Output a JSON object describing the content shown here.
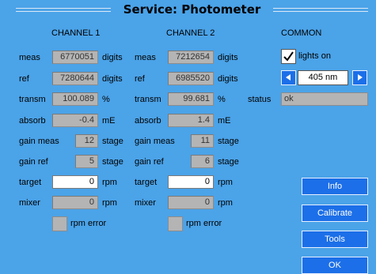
{
  "title": "Service: Photometer",
  "headers": {
    "channel1": "CHANNEL 1",
    "channel2": "CHANNEL 2",
    "common": "COMMON"
  },
  "labels": {
    "meas": "meas",
    "ref": "ref",
    "transm": "transm",
    "absorb": "absorb",
    "gain_meas": "gain meas",
    "gain_ref": "gain ref",
    "target": "target",
    "mixer": "mixer"
  },
  "units": {
    "digits": "digits",
    "percent": "%",
    "me": "mE",
    "stage": "stage",
    "rpm": "rpm"
  },
  "channel1": {
    "meas": "6770051",
    "ref": "7280644",
    "transm": "100.089",
    "absorb": "-0.4",
    "gain_meas": "12",
    "gain_ref": "5",
    "target": "0",
    "mixer": "0",
    "rpm_error_label": "rpm  error"
  },
  "channel2": {
    "meas": "7212654",
    "ref": "6985520",
    "transm": "99.681",
    "absorb": "1.4",
    "gain_meas": "11",
    "gain_ref": "6",
    "target": "0",
    "mixer": "0",
    "rpm_error_label": "rpm  error"
  },
  "common": {
    "lights_on_label": "lights  on",
    "lights_on_checked": true,
    "wavelength": "405  nm",
    "status_label": "status",
    "status_value": "ok"
  },
  "buttons": {
    "info": "Info",
    "calibrate": "Calibrate",
    "tools": "Tools",
    "ok": "OK"
  },
  "colors": {
    "background": "#4ba3e8",
    "button": "#1c6fe8",
    "readonly": "#b4b4b4"
  }
}
